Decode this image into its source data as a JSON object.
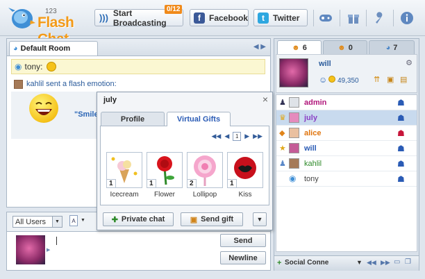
{
  "app": {
    "logo_version": "123",
    "logo_name": "Flash Chat"
  },
  "toolbar": {
    "broadcast_label": "Start Broadcasting",
    "broadcast_badge": "0/12",
    "facebook_label": "Facebook",
    "twitter_label": "Twitter",
    "icons": [
      "gamepad-icon",
      "gift-icon",
      "wrench-icon",
      "info-icon"
    ]
  },
  "room": {
    "tab_label": "Default Room",
    "messages": [
      {
        "user": "tony:",
        "emoji": "smile-emoji-icon"
      },
      {
        "text": "kahlil sent a flash emotion:",
        "flash_label": "\"Smile"
      }
    ]
  },
  "input": {
    "users_select": "All Users",
    "send_label": "Send",
    "newline_label": "Newline"
  },
  "user_panel": {
    "tabs": [
      {
        "icon": "users-icon",
        "count": "6"
      },
      {
        "icon": "group-icon",
        "count": "0"
      },
      {
        "icon": "chat-bubble-icon",
        "count": "7"
      }
    ],
    "current_user": {
      "name": "will",
      "coins": "49,350"
    },
    "users": [
      {
        "name": "admin",
        "color": "#b0157a"
      },
      {
        "name": "july",
        "color": "#8a3fc5"
      },
      {
        "name": "alice",
        "color": "#e0740c"
      },
      {
        "name": "will",
        "color": "#2a5bb5"
      },
      {
        "name": "kahlil",
        "color": "#2f8a2a"
      },
      {
        "name": "tony",
        "color": "#444444"
      }
    ],
    "bottom_label": "Social Conne"
  },
  "popup": {
    "title": "july",
    "tabs": [
      "Profile",
      "Virtual Gifts"
    ],
    "page": "1",
    "gifts": [
      {
        "name": "Icecream",
        "count": "1"
      },
      {
        "name": "Flower",
        "count": "1"
      },
      {
        "name": "Lollipop",
        "count": "2"
      },
      {
        "name": "Kiss",
        "count": "1"
      }
    ],
    "private_chat_label": "Private chat",
    "send_gift_label": "Send gift"
  }
}
